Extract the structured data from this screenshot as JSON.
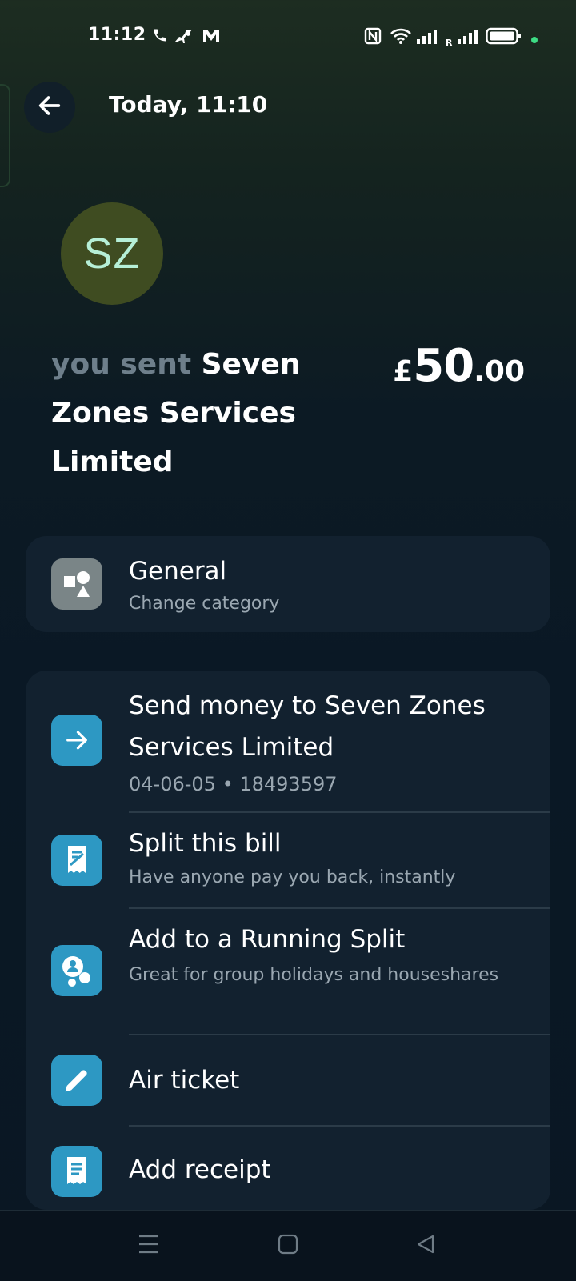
{
  "status_bar": {
    "time": "11:12",
    "icons": [
      "phone-icon",
      "horse-icon",
      "m-logo-icon",
      "nfc-icon",
      "wifi-icon",
      "signal-icon",
      "roaming-signal-icon",
      "battery-icon",
      "dot-indicator"
    ],
    "roaming_label": "R"
  },
  "header": {
    "back_icon": "arrow-left-icon",
    "title": "Today, 11:10"
  },
  "transaction": {
    "avatar_initials": "SZ",
    "prefix": "you sent",
    "payee": "Seven Zones Services Limited",
    "amount_currency": "£",
    "amount_whole": "50",
    "amount_decimal": ".00"
  },
  "category": {
    "icon": "shapes-icon",
    "title": "General",
    "subtitle": "Change category"
  },
  "actions": [
    {
      "icon": "arrow-right-icon",
      "title": "Send money to Seven Zones Services Limited",
      "subtitle": "04-06-05 • 18493597"
    },
    {
      "icon": "split-bill-icon",
      "title": "Split this bill",
      "subtitle": "Have anyone pay you back, instantly"
    },
    {
      "icon": "group-icon",
      "title": "Add to a Running Split",
      "subtitle": "Great for group holidays and houseshares"
    },
    {
      "icon": "pencil-icon",
      "title": "Air ticket",
      "subtitle": ""
    },
    {
      "icon": "receipt-icon",
      "title": "Add receipt",
      "subtitle": ""
    }
  ],
  "nav": {
    "icons": [
      "menu-icon",
      "home-square-icon",
      "back-triangle-icon"
    ]
  },
  "colors": {
    "accent_blue": "#2d98c3",
    "avatar_bg": "#3f4c21",
    "avatar_text": "#b6efd7",
    "card_bg": "#12212f",
    "muted_text": "#6e7f8b"
  }
}
